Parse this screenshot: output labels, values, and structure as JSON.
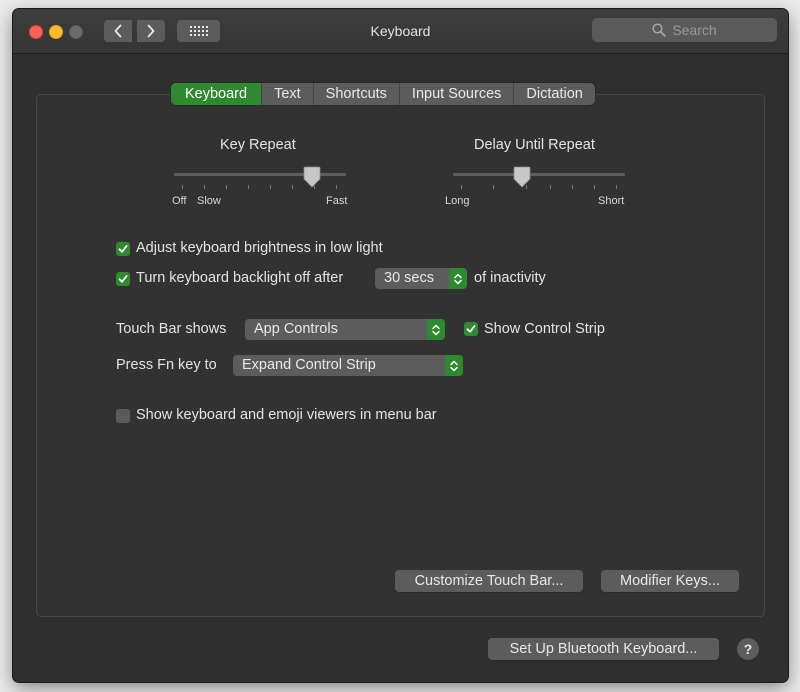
{
  "window": {
    "title": "Keyboard"
  },
  "toolbar": {
    "back_icon": "chevron-left-icon",
    "forward_icon": "chevron-right-icon",
    "grid_icon": "grid-icon",
    "search_placeholder": "Search"
  },
  "tabs": [
    {
      "label": "Keyboard",
      "active": true
    },
    {
      "label": "Text",
      "active": false
    },
    {
      "label": "Shortcuts",
      "active": false
    },
    {
      "label": "Input Sources",
      "active": false
    },
    {
      "label": "Dictation",
      "active": false
    }
  ],
  "key_repeat": {
    "title": "Key Repeat",
    "min_label": "Off",
    "slow_label": "Slow",
    "max_label": "Fast",
    "value_fraction": 0.8
  },
  "delay_repeat": {
    "title": "Delay Until Repeat",
    "min_label": "Long",
    "max_label": "Short",
    "value_fraction": 0.4
  },
  "options": {
    "adjust_brightness": {
      "label": "Adjust keyboard brightness in low light",
      "checked": true
    },
    "backlight_off": {
      "label": "Turn keyboard backlight off after",
      "checked": true,
      "value": "30 secs",
      "suffix": "of inactivity"
    },
    "touch_bar_shows": {
      "label": "Touch Bar shows",
      "value": "App Controls"
    },
    "show_control_strip": {
      "label": "Show Control Strip",
      "checked": true
    },
    "press_fn": {
      "label": "Press Fn key to",
      "value": "Expand Control Strip"
    },
    "show_viewers": {
      "label": "Show keyboard and emoji viewers in menu bar",
      "checked": false
    }
  },
  "buttons": {
    "customize_touch_bar": "Customize Touch Bar...",
    "modifier_keys": "Modifier Keys...",
    "bluetooth": "Set Up Bluetooth Keyboard...",
    "help": "?"
  },
  "colors": {
    "accent": "#2f8a2f",
    "window_bg": "#2f2f30"
  }
}
